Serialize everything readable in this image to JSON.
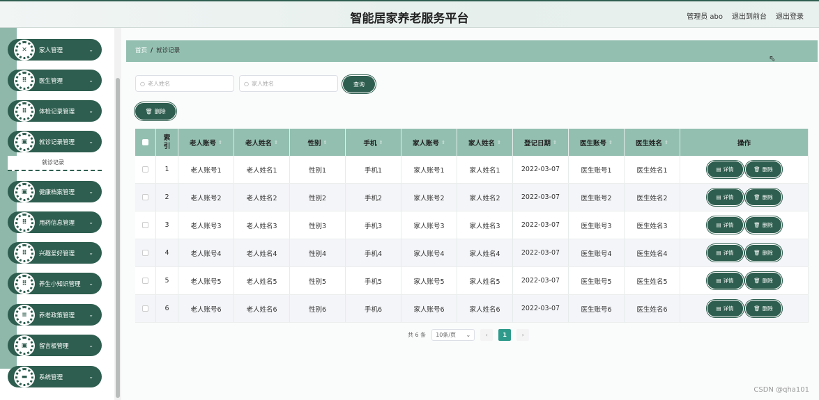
{
  "header": {
    "title": "智能居家养老服务平台",
    "admin": "管理员 abo",
    "to_front": "退出到前台",
    "logout": "退出登录"
  },
  "sidebar": {
    "items": [
      {
        "label": "家人管理",
        "icon": "ticket-icon"
      },
      {
        "label": "医生管理",
        "icon": "grid-icon"
      },
      {
        "label": "体检记录管理",
        "icon": "grid-icon"
      },
      {
        "label": "就诊记录管理",
        "icon": "doc-icon"
      },
      {
        "label": "健康档案管理",
        "icon": "doc-icon"
      },
      {
        "label": "用药信息管理",
        "icon": "grid-icon"
      },
      {
        "label": "兴趣爱好管理",
        "icon": "grid-icon"
      },
      {
        "label": "养生小知识管理",
        "icon": "grid-icon"
      },
      {
        "label": "养老政策管理",
        "icon": "list-icon"
      },
      {
        "label": "留言板管理",
        "icon": "doc-icon"
      },
      {
        "label": "系统管理",
        "icon": "monitor-icon"
      }
    ],
    "submenu_label": "就诊记录"
  },
  "breadcrumb": {
    "home": "首页",
    "sep": "/",
    "current": "就诊记录"
  },
  "search": {
    "elder_placeholder": "老人姓名",
    "family_placeholder": "家人姓名",
    "query_label": "查询",
    "delete_label": "删除"
  },
  "table": {
    "headers": [
      "索引",
      "老人账号",
      "老人姓名",
      "性别",
      "手机",
      "家人账号",
      "家人姓名",
      "登记日期",
      "医生账号",
      "医生姓名",
      "操作"
    ],
    "rows": [
      [
        "1",
        "老人账号1",
        "老人姓名1",
        "性别1",
        "手机1",
        "家人账号1",
        "家人姓名1",
        "2022-03-07",
        "医生账号1",
        "医生姓名1"
      ],
      [
        "2",
        "老人账号2",
        "老人姓名2",
        "性别2",
        "手机2",
        "家人账号2",
        "家人姓名2",
        "2022-03-07",
        "医生账号2",
        "医生姓名2"
      ],
      [
        "3",
        "老人账号3",
        "老人姓名3",
        "性别3",
        "手机3",
        "家人账号3",
        "家人姓名3",
        "2022-03-07",
        "医生账号3",
        "医生姓名3"
      ],
      [
        "4",
        "老人账号4",
        "老人姓名4",
        "性别4",
        "手机4",
        "家人账号4",
        "家人姓名4",
        "2022-03-07",
        "医生账号4",
        "医生姓名4"
      ],
      [
        "5",
        "老人账号5",
        "老人姓名5",
        "性别5",
        "手机5",
        "家人账号5",
        "家人姓名5",
        "2022-03-07",
        "医生账号5",
        "医生姓名5"
      ],
      [
        "6",
        "老人账号6",
        "老人姓名6",
        "性别6",
        "手机6",
        "家人账号6",
        "家人姓名6",
        "2022-03-07",
        "医生账号6",
        "医生姓名6"
      ]
    ],
    "detail_label": "详情",
    "delete_label": "删除"
  },
  "pagination": {
    "total": "共 6 条",
    "page_size": "10条/页",
    "current_page": "1"
  },
  "watermark": "CSDN @qha101",
  "colors": {
    "primary": "#2e5e4f",
    "header_bg": "#93bfb0",
    "page_active": "#2e9a8b"
  }
}
